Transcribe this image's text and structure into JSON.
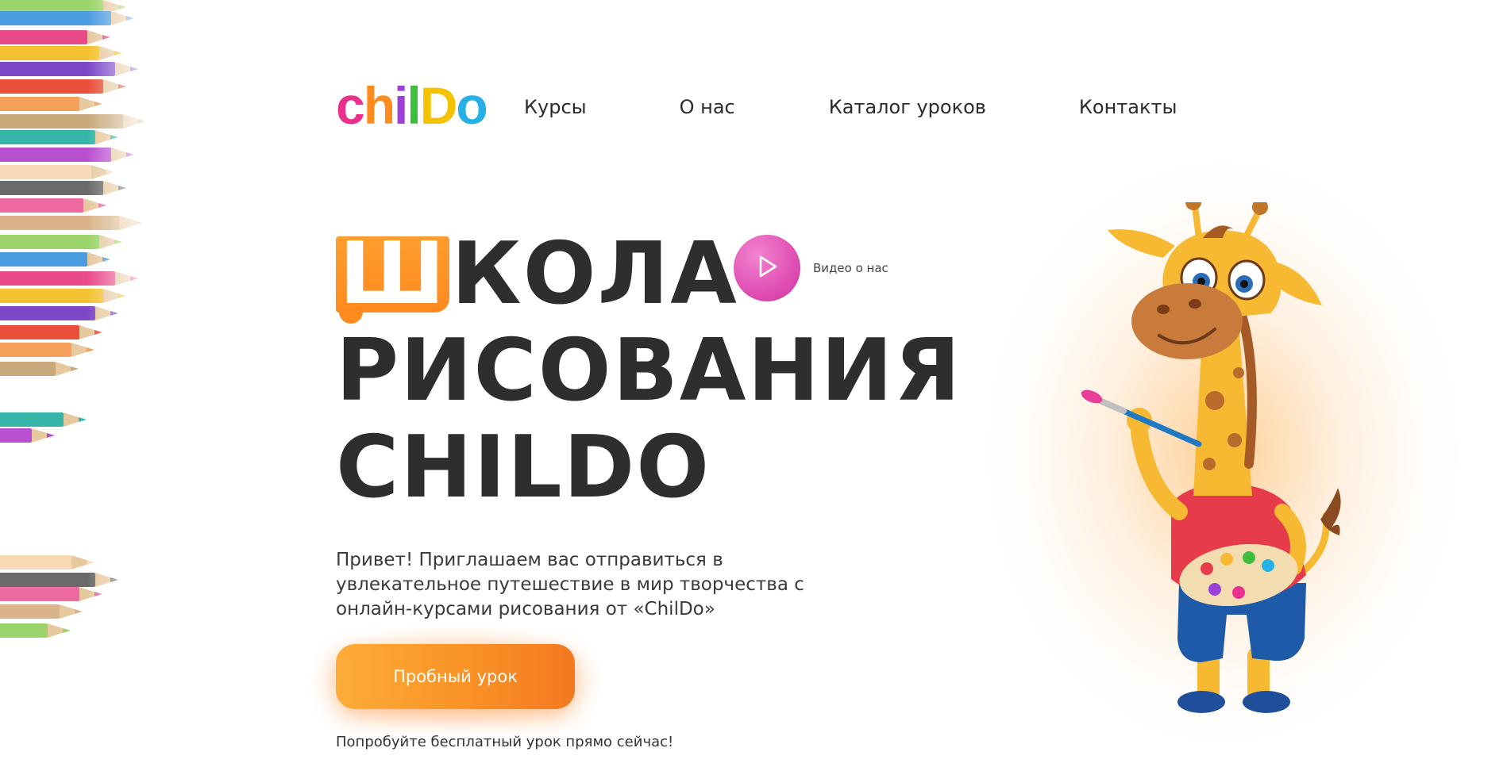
{
  "brand": {
    "logo_letters": [
      "c",
      "h",
      "i",
      "l",
      "D",
      "o"
    ],
    "logo_colors": [
      "#e8308c",
      "#ff8a1e",
      "#9c3fd6",
      "#3cbf3c",
      "#f5c200",
      "#25b1e6"
    ]
  },
  "nav": {
    "items": [
      {
        "label": "Курсы"
      },
      {
        "label": "О нас"
      },
      {
        "label": "Каталог уроков"
      },
      {
        "label": "Контакты"
      }
    ]
  },
  "hero": {
    "title_accent": "Ш",
    "title_line1_rest": "КОЛА",
    "title_line2": "РИСОВАНИЯ",
    "title_line3": "CHILDO",
    "video_label": "Видео о нас",
    "description": "Привет! Приглашаем вас отправиться в увлекательное путешествие в мир творчества с онлайн-курсами рисования от «ChilDo»",
    "cta_label": "Пробный урок",
    "cta_hint": "Попробуйте бесплатный урок прямо сейчас!"
  },
  "icons": {
    "video": "play-icon",
    "mascot": "giraffe-mascot-illustration",
    "decoration": "colored-pencils-decoration"
  },
  "colors": {
    "accent_orange": "#fa9527",
    "video_pink": "#e04fb3",
    "text_dark": "#2e2e2e"
  }
}
